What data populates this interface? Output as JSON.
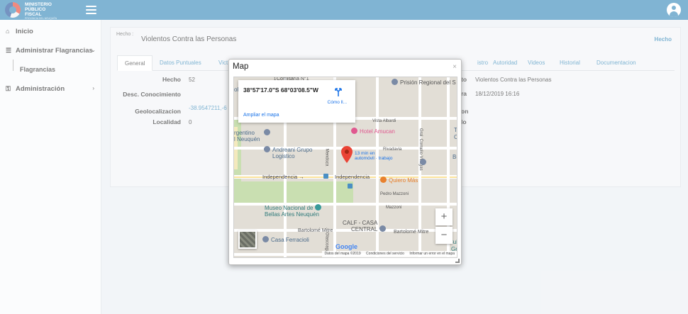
{
  "app": {
    "logo_lines": [
      "MINISTERIO",
      "PÚBLICO",
      "FISCAL"
    ],
    "logo_subtitle": "PROVINCIA DEL NEUQUÉN"
  },
  "sidebar": {
    "items": [
      {
        "label": "Inicio",
        "icon": "home-icon"
      },
      {
        "label": "Administrar Flagrancias",
        "icon": "list-icon"
      },
      {
        "label": "Flagrancias",
        "icon": ""
      },
      {
        "label": "Administración",
        "icon": "key-icon"
      }
    ]
  },
  "header": {
    "hecho_label": "Hecho :",
    "hecho_title": "Violentos Contra las Personas",
    "hecho_link": "Hecho"
  },
  "tabs": [
    {
      "label": "General",
      "active": true
    },
    {
      "label": "Datos Puntuales",
      "active": false
    },
    {
      "label": "Vict",
      "active": false
    },
    {
      "label": "istro",
      "active": false
    },
    {
      "label": "Autoridad",
      "active": false
    },
    {
      "label": "Videos",
      "active": false
    },
    {
      "label": "Historial",
      "active": false
    },
    {
      "label": "Documentacion",
      "active": false
    }
  ],
  "fields_left": [
    {
      "label": "Hecho",
      "value": "52"
    },
    {
      "label": "Desc. Conocimiento",
      "value": ""
    },
    {
      "label": "Geolocalizacion",
      "value": "-38.9547211,-6"
    },
    {
      "label": "Localidad",
      "value": "0"
    }
  ],
  "fields_right": [
    {
      "label": "to",
      "value": "Violentos Contra las Personas"
    },
    {
      "label": "ra",
      "value": "18/12/2019 16:16"
    },
    {
      "label": "on",
      "value": ""
    },
    {
      "label": "lo",
      "value": ""
    }
  ],
  "modal": {
    "title": "Map",
    "close": "×"
  },
  "map": {
    "coords": "38°57'17.0\"S 68°03'08.5\"W",
    "directions_label": "Cómo ll...",
    "ampliar": "Ampliar el mapa",
    "drive_time": [
      "13 min en",
      "automóvil · trabajo"
    ],
    "labels": {
      "comisaria": "Comisaría N°1",
      "prision": "Prisión Regional del S",
      "amucan": "Hotel Amucan",
      "albardi": "Vista Albardi",
      "rivadavia": "Rivadavia",
      "andreani_1": "Andreani Grupo",
      "andreani_2": "Logistico",
      "gentino": "rgentino",
      "neuquen": "l Neuquén",
      "indep_1": "Independencia →",
      "indep_2": "Independencia",
      "quiero": "Quiero Más",
      "mazzoni_1": "Pedro Mazzoni",
      "mazzoni_2": "Mazzoni",
      "museo_1": "Museo Nacional de",
      "museo_2": "Bellas Artes Neuquén",
      "calf_1": "CALF - CASA",
      "calf_2": "CENTRAL",
      "mitre_1": "Bartolomé Mitre",
      "mitre_2": "Bartolomé Mitre",
      "ferraciol": "Casa Ferracioli",
      "mendoza": "Mendoza",
      "correo": "Gral. Cornelio Villegas",
      "olascoaga": "Olascoaga",
      "tc": "TC",
      "ca": "C",
      "bu": "Bu",
      "ol": "ol",
      "cul": "Cul",
      "gr": "Gr",
      "uno": "1"
    },
    "zoom_in": "+",
    "zoom_out": "−",
    "google": "Google",
    "attribution": [
      "Datos del mapa ©2019",
      "Condiciones del servicio",
      "Informar un error en el mapa"
    ]
  },
  "colors": {
    "primary": "#3c8dbc",
    "marker": "#ea4335"
  }
}
